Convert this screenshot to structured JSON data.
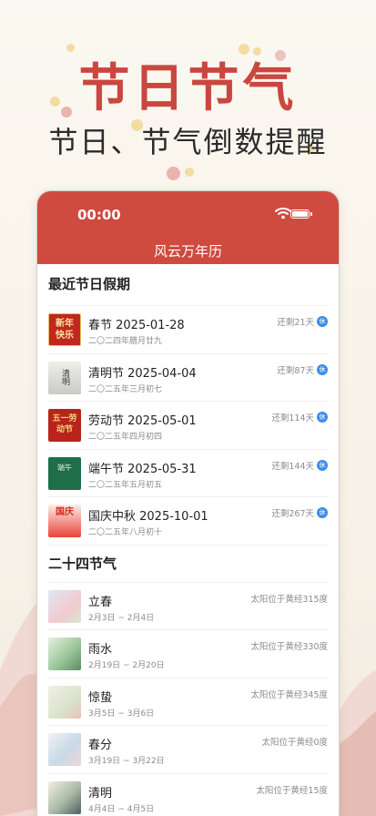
{
  "hero": {
    "title": "节日节气",
    "subtitle": "节日、节气倒数提醒"
  },
  "status_bar": {
    "time": "00:00"
  },
  "nav": {
    "title": "风云万年历"
  },
  "holidays": {
    "section_title": "最近节日假期",
    "items": [
      {
        "title": "春节 2025-01-28",
        "lunar": "二〇二四年腊月廿九",
        "countdown": "还剩21天",
        "badge": "休",
        "thumb_text": "新年快乐"
      },
      {
        "title": "清明节 2025-04-04",
        "lunar": "二〇二五年三月初七",
        "countdown": "还剩87天",
        "badge": "休",
        "thumb_text": "清明"
      },
      {
        "title": "劳动节 2025-05-01",
        "lunar": "二〇二五年四月初四",
        "countdown": "还剩114天",
        "badge": "休",
        "thumb_text": "五一劳动节"
      },
      {
        "title": "端午节 2025-05-31",
        "lunar": "二〇二五年五月初五",
        "countdown": "还剩144天",
        "badge": "休",
        "thumb_text": "端午"
      },
      {
        "title": "国庆中秋 2025-10-01",
        "lunar": "二〇二五年八月初十",
        "countdown": "还剩267天",
        "badge": "休",
        "thumb_text": "国庆"
      }
    ]
  },
  "solar_terms": {
    "section_title": "二十四节气",
    "items": [
      {
        "title": "立春",
        "dates": "2月3日 ~ 2月4日",
        "sun": "太阳位于黄经315度"
      },
      {
        "title": "雨水",
        "dates": "2月19日 ~ 2月20日",
        "sun": "太阳位于黄经330度"
      },
      {
        "title": "惊蛰",
        "dates": "3月5日 ~ 3月6日",
        "sun": "太阳位于黄经345度"
      },
      {
        "title": "春分",
        "dates": "3月19日 ~ 3月22日",
        "sun": "太阳位于黄经0度"
      },
      {
        "title": "清明",
        "dates": "4月4日 ~ 4月5日",
        "sun": "太阳位于黄经15度"
      }
    ]
  },
  "colors": {
    "brand_red": "#cf4a3f",
    "title_red": "#c9473f",
    "rest_badge_blue": "#3b8ce8"
  }
}
